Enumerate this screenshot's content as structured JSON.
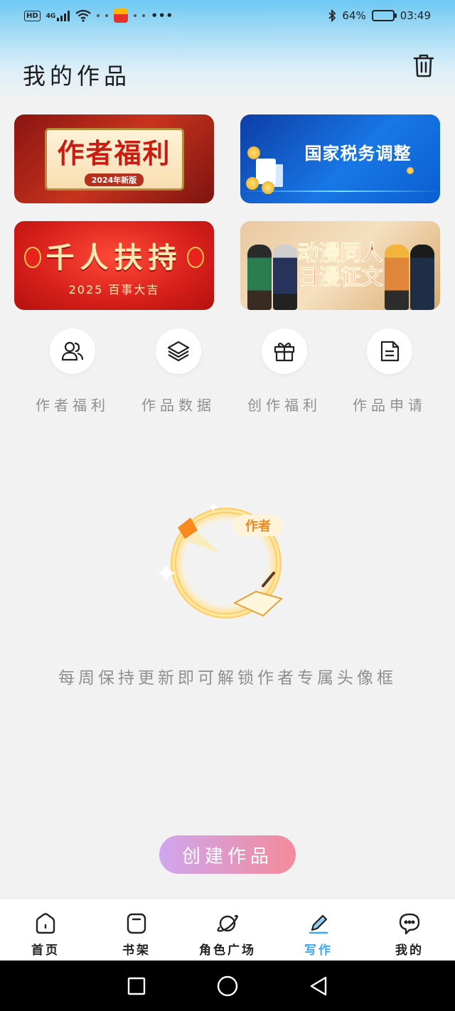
{
  "status_bar": {
    "hd": "HD",
    "network": "4G",
    "bluetooth_icon": "bluetooth-icon",
    "battery_text": "64%",
    "battery_level": 0.64,
    "time": "03:49"
  },
  "header": {
    "title": "我的作品",
    "trash_icon": "trash-icon"
  },
  "banners": [
    {
      "title": "作者福利",
      "subtitle": "2024年新版"
    },
    {
      "title": "国家税务调整"
    },
    {
      "title": "千人扶持",
      "subtitle": "2025 百事大吉"
    },
    {
      "title_line1": "动漫同人",
      "title_line2": "日漫征文"
    }
  ],
  "actions": [
    {
      "label": "作者福利",
      "icon": "users-icon"
    },
    {
      "label": "作品数据",
      "icon": "layers-icon"
    },
    {
      "label": "创作福利",
      "icon": "gift-icon"
    },
    {
      "label": "作品申请",
      "icon": "document-icon"
    }
  ],
  "empty_state": {
    "badge_text": "作者",
    "message": "每周保持更新即可解锁作者专属头像框"
  },
  "create_button": {
    "label": "创建作品"
  },
  "tabs": [
    {
      "label": "首页",
      "icon": "home-icon",
      "active": false
    },
    {
      "label": "书架",
      "icon": "bookshelf-icon",
      "active": false
    },
    {
      "label": "角色广场",
      "icon": "planet-icon",
      "active": false
    },
    {
      "label": "写作",
      "icon": "pen-icon",
      "active": true
    },
    {
      "label": "我的",
      "icon": "chat-icon",
      "active": false
    }
  ],
  "colors": {
    "active_tab": "#3aa7f0",
    "create_gradient_start": "#cfa6ee",
    "create_gradient_end": "#f38b9b"
  }
}
